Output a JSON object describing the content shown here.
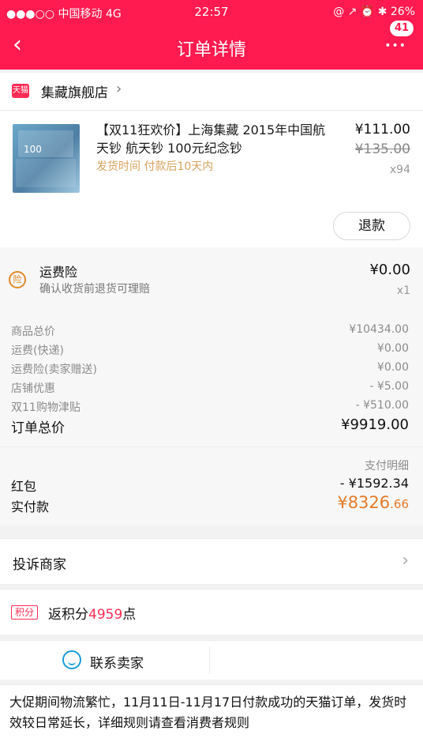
{
  "status": {
    "carrier": "●●●○○ 中国移动  4G",
    "time": "22:57",
    "right": "@  ↗  ⏰  ✱ 26%"
  },
  "nav": {
    "back": "‹",
    "title": "订单详情",
    "badge": "41",
    "more": "•••"
  },
  "store": {
    "logo": "天猫",
    "name": "集藏旗舰店",
    "chevron": "›"
  },
  "product": {
    "thumb_text": "100",
    "title": "【双11狂欢价】上海集藏  2015年中国航天钞 航天钞 100元纪念钞",
    "shipping": "发货时间  付款后10天内",
    "price": "¥111.00",
    "old_price": "¥135.00",
    "qty": "x94",
    "refund": "退款"
  },
  "insurance": {
    "icon": "险",
    "title": "运费险",
    "subtitle": "确认收货前退货可理赔",
    "price": "¥0.00",
    "qty": "x1"
  },
  "summary": [
    {
      "k": "商品总价",
      "v": "¥10434.00"
    },
    {
      "k": "运费(快递)",
      "v": "¥0.00"
    },
    {
      "k": "运费险(卖家赠送)",
      "v": "¥0.00"
    },
    {
      "k": "店铺优惠",
      "v": "- ¥5.00"
    },
    {
      "k": "双11购物津贴",
      "v": "- ¥510.00"
    },
    {
      "k": "订单总价",
      "v": "¥9919.00"
    }
  ],
  "payment": {
    "detail": "支付明细",
    "redpack_label": "红包",
    "redpack_value": "- ¥1592.34",
    "actual_label": "实付款",
    "actual_main": "¥8326",
    "actual_decimal": ".66"
  },
  "complaint": {
    "label": "投诉商家",
    "chevron": "›"
  },
  "points": {
    "tag": "积分",
    "prefix": "返积分",
    "value": "4959",
    "suffix": "点"
  },
  "contact": {
    "label": "联系卖家"
  },
  "notice": {
    "text": "大促期间物流繁忙，11月11日-11月17日付款成功的天猫订单，发货时效较日常延长，详细规则请查看消费者规则"
  }
}
